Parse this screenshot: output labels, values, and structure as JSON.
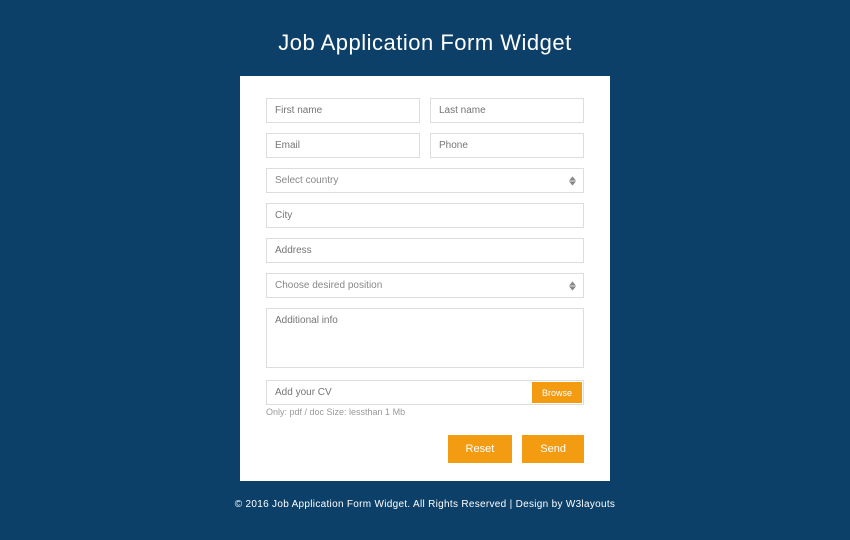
{
  "title": "Job Application Form Widget",
  "fields": {
    "first_name": "First name",
    "last_name": "Last name",
    "email": "Email",
    "phone": "Phone",
    "country": "Select country",
    "city": "City",
    "address": "Address",
    "position": "Choose desired position",
    "additional_info": "Additional info",
    "cv": "Add your CV"
  },
  "buttons": {
    "browse": "Browse",
    "reset": "Reset",
    "send": "Send"
  },
  "hint": "Only: pdf / doc Size: lessthan 1 Mb",
  "footer": "© 2016 Job Application Form Widget. All Rights Reserved | Design by W3layouts"
}
